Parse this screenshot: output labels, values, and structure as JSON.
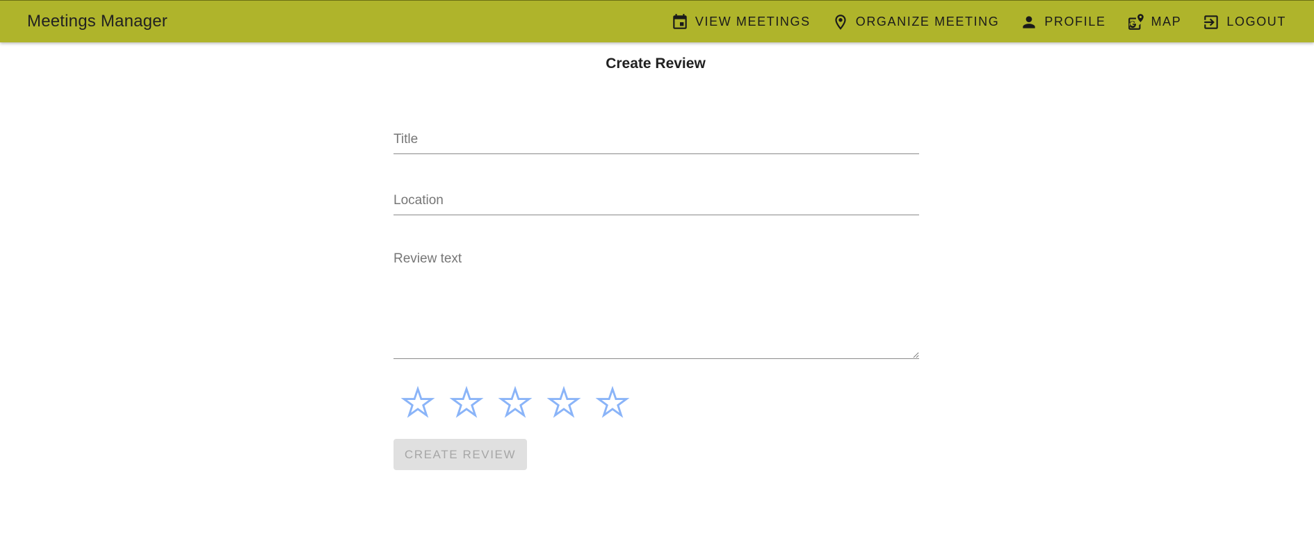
{
  "app": {
    "title": "Meetings Manager"
  },
  "nav": {
    "items": [
      {
        "label": "VIEW MEETINGS",
        "icon": "calendar-icon"
      },
      {
        "label": "ORGANIZE MEETING",
        "icon": "location-pin-icon"
      },
      {
        "label": "PROFILE",
        "icon": "person-icon"
      },
      {
        "label": "MAP",
        "icon": "map-icon"
      },
      {
        "label": "LOGOUT",
        "icon": "logout-icon"
      }
    ]
  },
  "page": {
    "title": "Create Review"
  },
  "form": {
    "title_placeholder": "Title",
    "title_value": "",
    "location_placeholder": "Location",
    "location_value": "",
    "review_placeholder": "Review text",
    "review_value": "",
    "rating": 0,
    "rating_max": 5,
    "star_color": "#8ab4f8",
    "submit_label": "CREATE REVIEW",
    "submit_disabled": true
  },
  "colors": {
    "appbar": "#afb42b",
    "text": "#212121"
  }
}
